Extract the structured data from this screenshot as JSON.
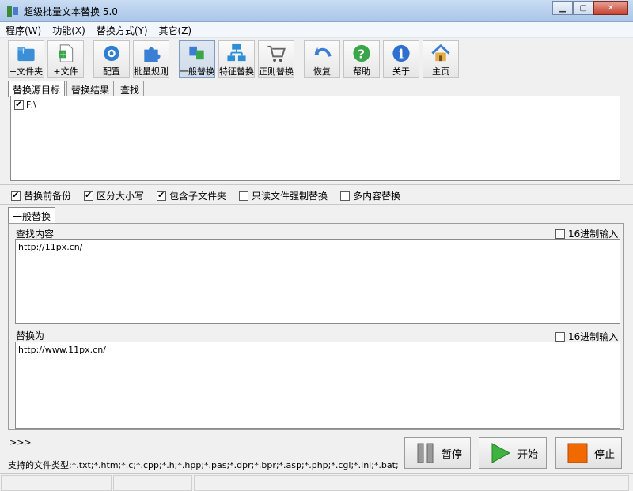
{
  "window": {
    "title": "超级批量文本替换 5.0"
  },
  "menu": [
    "程序(W)",
    "功能(X)",
    "替换方式(Y)",
    "其它(Z)"
  ],
  "toolbar": [
    {
      "label": "+文件夹",
      "icon": "add-folder-icon"
    },
    {
      "label": "+文件",
      "icon": "add-file-icon"
    },
    {
      "label": "配置",
      "icon": "config-icon"
    },
    {
      "label": "批量规则",
      "icon": "puzzle-icon"
    },
    {
      "label": "一般替换",
      "icon": "replace-icon",
      "pressed": true
    },
    {
      "label": "特征替换",
      "icon": "tree-icon"
    },
    {
      "label": "正则替换",
      "icon": "cart-icon"
    },
    {
      "label": "恢复",
      "icon": "undo-icon"
    },
    {
      "label": "帮助",
      "icon": "help-icon"
    },
    {
      "label": "关于",
      "icon": "info-icon"
    },
    {
      "label": "主页",
      "icon": "home-icon"
    }
  ],
  "tabs": [
    "替换源目标",
    "替换结果",
    "查找"
  ],
  "tree": {
    "item": "F:\\"
  },
  "options": [
    {
      "label": "替换前备份",
      "checked": true
    },
    {
      "label": "区分大小写",
      "checked": true
    },
    {
      "label": "包含子文件夹",
      "checked": true
    },
    {
      "label": "只读文件强制替换",
      "checked": false
    },
    {
      "label": "多内容替换",
      "checked": false
    }
  ],
  "replace_tab": "一般替换",
  "find": {
    "label": "查找内容",
    "hex": "16进制输入",
    "value": "http://11px.cn/"
  },
  "replace": {
    "label": "替换为",
    "hex": "16进制输入",
    "value": "http://www.11px.cn/"
  },
  "bottom": {
    "prompt": ">>>",
    "filetypes": "支持的文件类型:*.txt;*.htm;*.c;*.cpp;*.h;*.hpp;*.pas;*.dpr;*.bpr;*.asp;*.php;*.cgi;*.ini;*.bat;*.inc;*.java;*.py;*.dfm"
  },
  "buttons": {
    "pause": "暂停",
    "start": "开始",
    "stop": "停止"
  }
}
